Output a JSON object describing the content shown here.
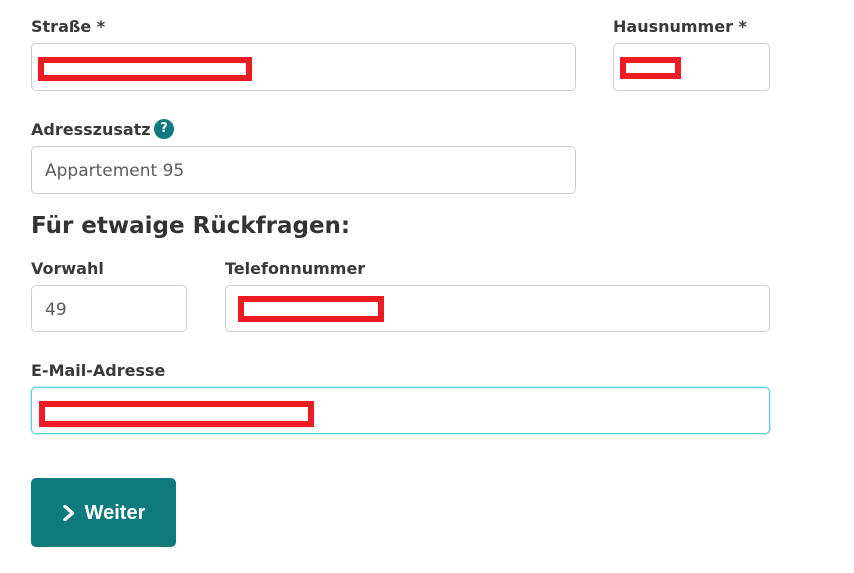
{
  "form": {
    "street": {
      "label": "Straße *",
      "value": ""
    },
    "house_number": {
      "label": "Hausnummer *",
      "value": ""
    },
    "address_suffix": {
      "label": "Adresszusatz",
      "help_icon": "question-circle-icon",
      "value": "Appartement 95"
    },
    "section_heading": "Für etwaige Rückfragen:",
    "area_code": {
      "label": "Vorwahl",
      "value": "49"
    },
    "phone": {
      "label": "Telefonnummer",
      "value": ""
    },
    "email": {
      "label": "E-Mail-Adresse",
      "value": ""
    },
    "help_symbol": "?"
  },
  "submit_button": {
    "label": "Weiter",
    "icon": "chevron-right-icon"
  },
  "colors": {
    "primary": "#0f7a7d",
    "redaction": "#ed1c24",
    "focus_border": "#5bd3d8",
    "input_border": "#cfcfcf"
  }
}
